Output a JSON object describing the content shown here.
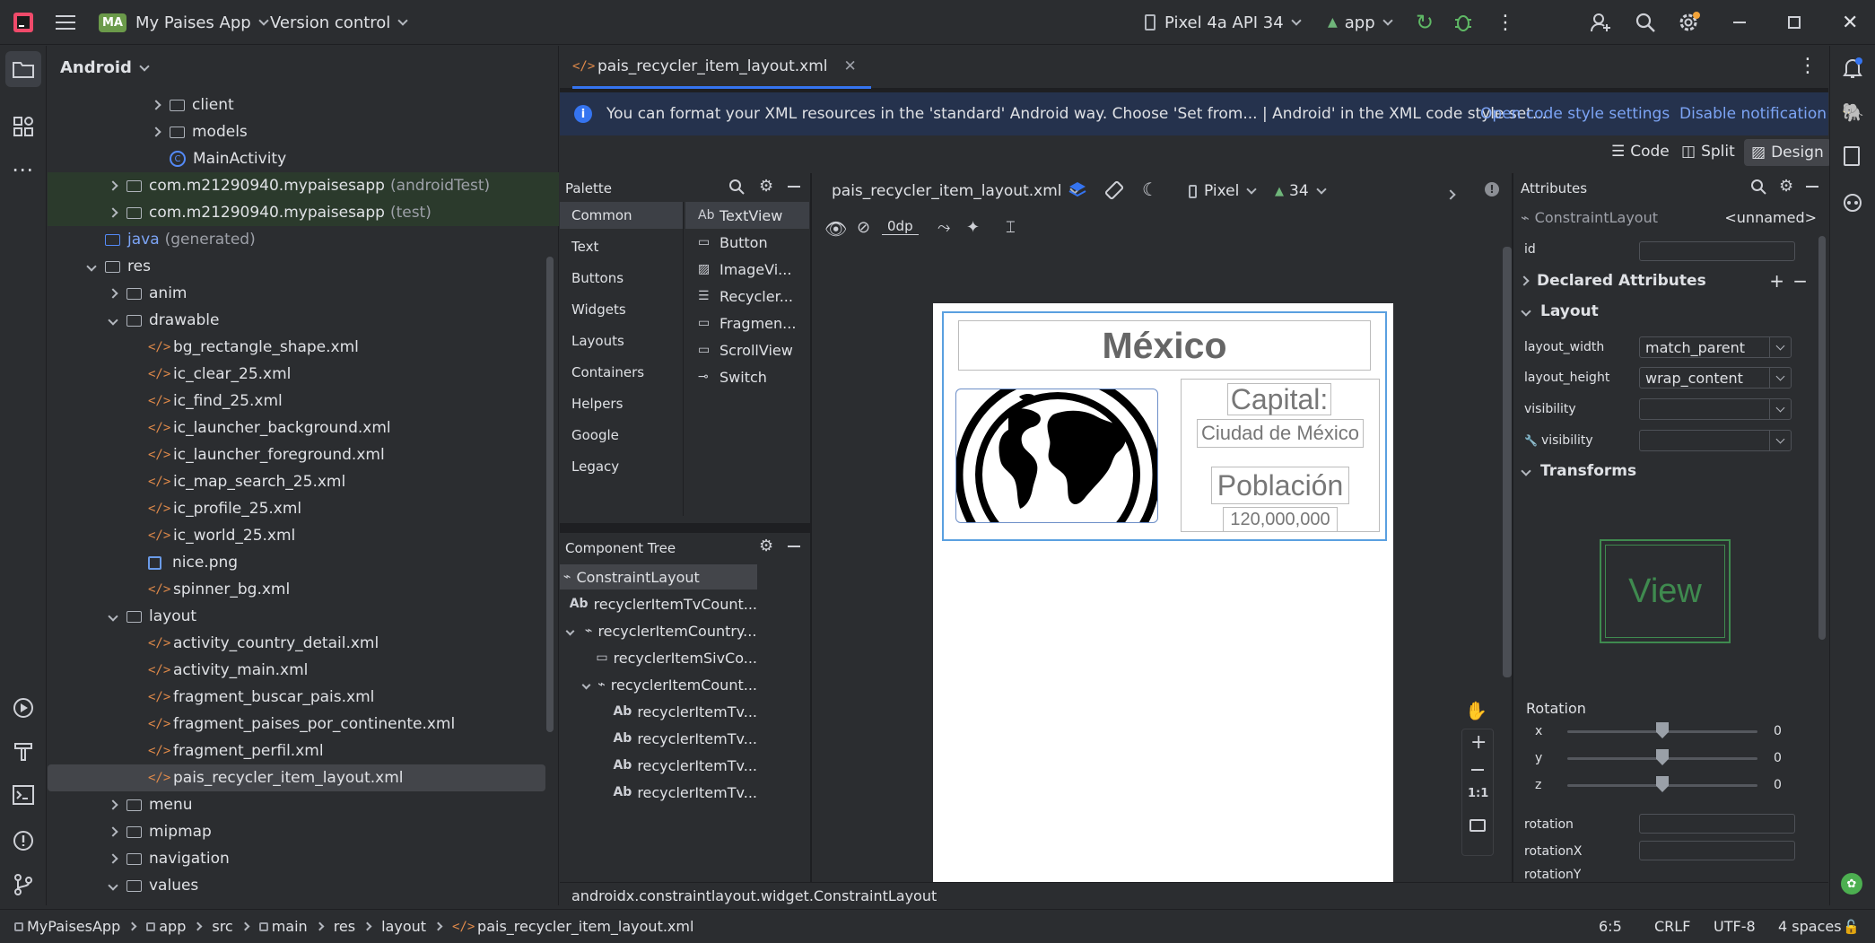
{
  "titlebar": {
    "project_badge": "MA",
    "project_name": "My Paises App",
    "vcs": "Version control",
    "device": "Pixel 4a API 34",
    "run_config": "app"
  },
  "project_panel": {
    "title": "Android",
    "items": [
      {
        "label": "client",
        "indent": 5,
        "type": "package",
        "expand": ">"
      },
      {
        "label": "models",
        "indent": 5,
        "type": "package",
        "expand": ">"
      },
      {
        "label": "MainActivity",
        "indent": 5,
        "type": "class",
        "expand": ""
      },
      {
        "label": "com.m21290940.mypaisesapp",
        "suffix": "(androidTest)",
        "indent": 3,
        "type": "package",
        "expand": ">",
        "hl": true
      },
      {
        "label": "com.m21290940.mypaisesapp",
        "suffix": "(test)",
        "indent": 3,
        "type": "package",
        "expand": ">",
        "hl": true
      },
      {
        "label": "java",
        "suffix": "(generated)",
        "indent": 2,
        "type": "folder",
        "expand": ""
      },
      {
        "label": "res",
        "indent": 2,
        "type": "folder",
        "expand": "v"
      },
      {
        "label": "anim",
        "indent": 3,
        "type": "folder",
        "expand": ">"
      },
      {
        "label": "drawable",
        "indent": 3,
        "type": "folder",
        "expand": "v"
      },
      {
        "label": "bg_rectangle_shape.xml",
        "indent": 4,
        "type": "xml"
      },
      {
        "label": "ic_clear_25.xml",
        "indent": 4,
        "type": "xml"
      },
      {
        "label": "ic_find_25.xml",
        "indent": 4,
        "type": "xml"
      },
      {
        "label": "ic_launcher_background.xml",
        "indent": 4,
        "type": "xml"
      },
      {
        "label": "ic_launcher_foreground.xml",
        "indent": 4,
        "type": "xml"
      },
      {
        "label": "ic_map_search_25.xml",
        "indent": 4,
        "type": "xml"
      },
      {
        "label": "ic_profile_25.xml",
        "indent": 4,
        "type": "xml"
      },
      {
        "label": "ic_world_25.xml",
        "indent": 4,
        "type": "xml"
      },
      {
        "label": "nice.png",
        "indent": 4,
        "type": "png"
      },
      {
        "label": "spinner_bg.xml",
        "indent": 4,
        "type": "xml"
      },
      {
        "label": "layout",
        "indent": 3,
        "type": "folder",
        "expand": "v"
      },
      {
        "label": "activity_country_detail.xml",
        "indent": 4,
        "type": "xml"
      },
      {
        "label": "activity_main.xml",
        "indent": 4,
        "type": "xml"
      },
      {
        "label": "fragment_buscar_pais.xml",
        "indent": 4,
        "type": "xml"
      },
      {
        "label": "fragment_paises_por_continente.xml",
        "indent": 4,
        "type": "xml"
      },
      {
        "label": "fragment_perfil.xml",
        "indent": 4,
        "type": "xml"
      },
      {
        "label": "pais_recycler_item_layout.xml",
        "indent": 4,
        "type": "xml",
        "selected": true
      },
      {
        "label": "menu",
        "indent": 3,
        "type": "folder",
        "expand": ">"
      },
      {
        "label": "mipmap",
        "indent": 3,
        "type": "folder",
        "expand": ">"
      },
      {
        "label": "navigation",
        "indent": 3,
        "type": "folder",
        "expand": ">"
      },
      {
        "label": "values",
        "indent": 3,
        "type": "folder",
        "expand": "v"
      }
    ]
  },
  "editor": {
    "tab": "pais_recycler_item_layout.xml",
    "notification": "You can format your XML resources in the 'standard' Android way. Choose 'Set from... | Android' in the XML code style set...",
    "notif_link1": "Open code style settings",
    "notif_link2": "Disable notification",
    "modes": {
      "code": "Code",
      "split": "Split",
      "design": "Design"
    },
    "palette": {
      "title": "Palette",
      "categories": [
        "Common",
        "Text",
        "Buttons",
        "Widgets",
        "Layouts",
        "Containers",
        "Helpers",
        "Google",
        "Legacy"
      ],
      "widgets": [
        {
          "icon": "Ab",
          "label": "TextView"
        },
        {
          "icon": "▭",
          "label": "Button"
        },
        {
          "icon": "▨",
          "label": "ImageVi..."
        },
        {
          "icon": "☰",
          "label": "Recycler..."
        },
        {
          "icon": "▭",
          "label": "Fragmen..."
        },
        {
          "icon": "▭",
          "label": "ScrollView"
        },
        {
          "icon": "⊸",
          "label": "Switch"
        }
      ]
    },
    "component_tree": {
      "title": "Component Tree",
      "items": [
        {
          "label": "ConstraintLayout",
          "indent": 0,
          "icon": "⌁",
          "sel": true
        },
        {
          "label": "recyclerItemTvCount...",
          "indent": 1,
          "icon": "Ab"
        },
        {
          "label": "recyclerItemCountry...",
          "indent": 1,
          "icon": "⌁",
          "expand": true
        },
        {
          "label": "recyclerItemSivCo...",
          "indent": 2,
          "icon": "▭"
        },
        {
          "label": "recyclerItemCount...",
          "indent": 2,
          "icon": "⌁",
          "expand": true
        },
        {
          "label": "recyclerItemTv...",
          "indent": 3,
          "icon": "Ab"
        },
        {
          "label": "recyclerItemTv...",
          "indent": 3,
          "icon": "Ab"
        },
        {
          "label": "recyclerItemTv...",
          "indent": 3,
          "icon": "Ab"
        },
        {
          "label": "recyclerItemTv...",
          "indent": 3,
          "icon": "Ab"
        }
      ]
    },
    "design_toolbar": {
      "file": "pais_recycler_item_layout.xml",
      "device": "Pixel",
      "api": "34",
      "margin": "0dp"
    },
    "preview": {
      "country": "México",
      "capital_label": "Capital:",
      "capital_value": "Ciudad de México",
      "population_label": "Población",
      "population_value": "120,000,000"
    },
    "zoom_fit": "1:1",
    "status_class": "androidx.constraintlayout.widget.ConstraintLayout"
  },
  "attributes": {
    "title": "Attributes",
    "component": "ConstraintLayout",
    "name": "<unnamed>",
    "id_label": "id",
    "declared": "Declared Attributes",
    "layout_section": "Layout",
    "layout_width_label": "layout_width",
    "layout_width": "match_parent",
    "layout_height_label": "layout_height",
    "layout_height": "wrap_content",
    "visibility": "visibility",
    "visibility2": "visibility",
    "transforms": "Transforms",
    "view_label": "View",
    "rotation_title": "Rotation",
    "rot_x_label": "x",
    "rot_x": "0",
    "rot_y_label": "y",
    "rot_y": "0",
    "rot_z_label": "z",
    "rot_z": "0",
    "rotation": "rotation",
    "rotationX": "rotationX",
    "rotationY": "rotationY"
  },
  "breadcrumb": [
    "MyPaisesApp",
    "app",
    "src",
    "main",
    "res",
    "layout",
    "pais_recycler_item_layout.xml"
  ],
  "status": {
    "position": "6:5",
    "line_sep": "CRLF",
    "encoding": "UTF-8",
    "indent": "4 spaces"
  },
  "colors": {
    "accent": "#3574f0",
    "selection": "#2e436e",
    "green_hl": "#2c3a2c"
  }
}
